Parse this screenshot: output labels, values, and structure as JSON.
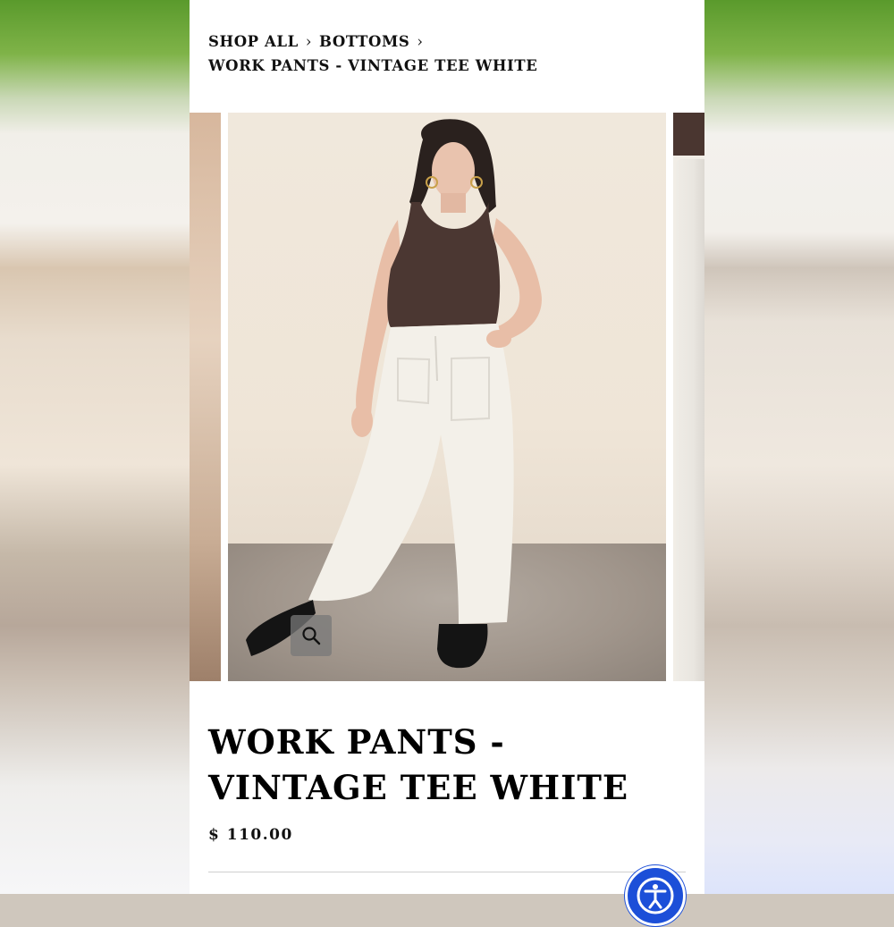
{
  "breadcrumb": {
    "shop_all": "SHOP ALL",
    "bottoms": "BOTTOMS",
    "current": "WORK PANTS - VINTAGE TEE WHITE",
    "separator": "›"
  },
  "gallery": {
    "zoom_icon": "search-icon"
  },
  "product": {
    "title_line1": "WORK PANTS -",
    "title_line2": "VINTAGE TEE WHITE",
    "price": "$ 110.00"
  },
  "accessibility": {
    "icon": "accessibility-icon",
    "color": "#1c4fd8"
  }
}
